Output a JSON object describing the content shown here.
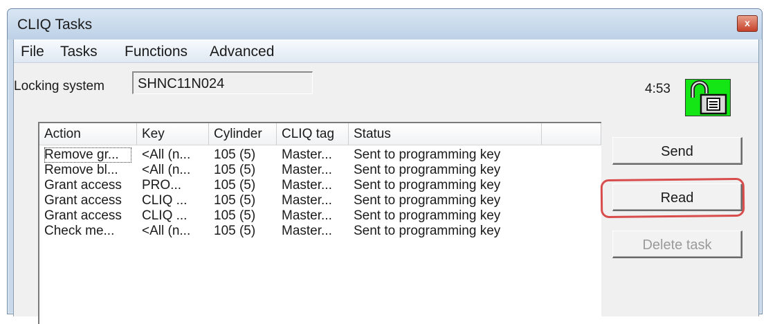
{
  "window": {
    "title": "CLIQ Tasks",
    "close_symbol": "x"
  },
  "menu": {
    "items": [
      "File",
      "Tasks",
      "Functions",
      "Advanced"
    ]
  },
  "locking_system": {
    "label": "Locking system",
    "value": "SHNC11N024"
  },
  "timer": "4:53",
  "lock_status": {
    "icon": "padlock-open-icon",
    "color": "#14e514"
  },
  "table": {
    "columns": [
      "Action",
      "Key",
      "Cylinder",
      "CLIQ tag",
      "Status",
      ""
    ],
    "rows": [
      [
        "Remove gr...",
        "<All (n...",
        "105 (5)",
        "Master...",
        "Sent to programming key"
      ],
      [
        "Remove bl...",
        "<All (n...",
        "105 (5)",
        "Master...",
        "Sent to programming key"
      ],
      [
        "Grant access",
        "PRO...",
        "105 (5)",
        "Master...",
        "Sent to programming key"
      ],
      [
        "Grant access",
        "CLIQ ...",
        "105 (5)",
        "Master...",
        "Sent to programming key"
      ],
      [
        "Grant access",
        "CLIQ ...",
        "105 (5)",
        "Master...",
        "Sent to programming key"
      ],
      [
        "Check me...",
        "<All (n...",
        "105 (5)",
        "Master...",
        "Sent to programming key"
      ]
    ]
  },
  "buttons": {
    "send": "Send",
    "read": "Read",
    "delete_task": "Delete task"
  },
  "colors": {
    "highlight": "#d94c4c"
  }
}
